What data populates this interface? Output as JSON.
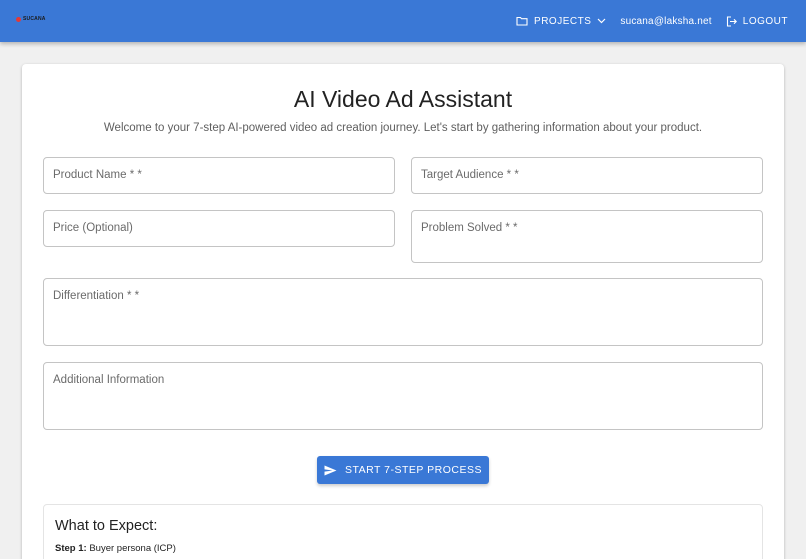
{
  "header": {
    "logo_text": "SUCANA",
    "projects_label": "PROJECTS",
    "user_email": "sucana@laksha.net",
    "logout_label": "LOGOUT"
  },
  "main": {
    "title": "AI Video Ad Assistant",
    "subtitle": "Welcome to your 7-step AI-powered video ad creation journey. Let's start by gathering information about your product.",
    "fields": {
      "product_name": {
        "label": "Product Name * *",
        "value": ""
      },
      "target_audience": {
        "label": "Target Audience * *",
        "value": ""
      },
      "price": {
        "label": "Price (Optional)",
        "value": ""
      },
      "problem_solved": {
        "label": "Problem Solved * *",
        "value": ""
      },
      "differentiation": {
        "label": "Differentiation * *",
        "value": ""
      },
      "additional_info": {
        "label": "Additional Information",
        "value": ""
      }
    },
    "start_button_label": "START 7-STEP PROCESS",
    "expect": {
      "title": "What to Expect:",
      "steps": [
        {
          "prefix": "Step 1:",
          "text": "Buyer persona (ICP)"
        }
      ]
    }
  },
  "colors": {
    "primary": "#3a78d6",
    "background": "#f0f0f0",
    "logo_accent": "#e53935"
  },
  "icons": [
    "folder-icon",
    "chevron-down-icon",
    "logout-icon",
    "send-icon"
  ]
}
